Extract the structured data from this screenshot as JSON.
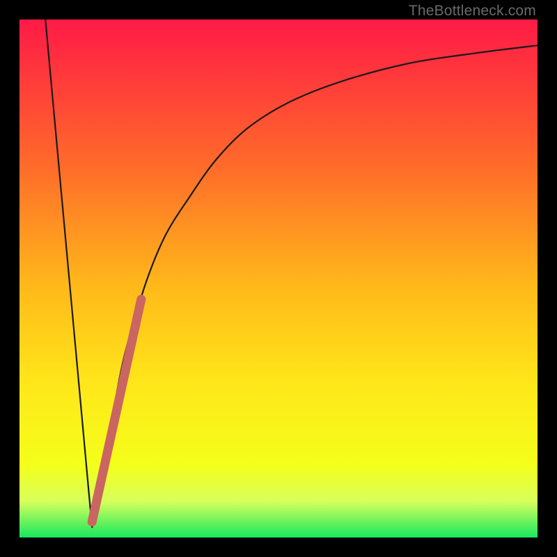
{
  "watermark": "TheBottleneck.com",
  "colors": {
    "frame": "#000000",
    "gradient_top": "#ff1a46",
    "gradient_mid1": "#ff6a2a",
    "gradient_mid2": "#ffba1a",
    "gradient_mid3": "#ffe61a",
    "gradient_mid4": "#f4ff1a",
    "gradient_green_band_top": "#d8ff5c",
    "gradient_green_band_bottom": "#17e85e",
    "curve_stroke": "#1a1a1a",
    "highlight_stroke": "#cb6561"
  },
  "chart_data": {
    "type": "line",
    "title": "",
    "xlabel": "",
    "ylabel": "",
    "xlim": [
      0,
      100
    ],
    "ylim": [
      0,
      100
    ],
    "series": [
      {
        "name": "left-descent",
        "x": [
          5,
          14
        ],
        "y": [
          100,
          2
        ]
      },
      {
        "name": "right-curve",
        "x": [
          14,
          17,
          20,
          24,
          28,
          33,
          38,
          44,
          52,
          62,
          75,
          88,
          100
        ],
        "y": [
          2,
          18,
          34,
          48,
          58,
          66,
          73,
          79,
          84,
          88,
          91.5,
          93.5,
          95
        ]
      }
    ],
    "highlight_segment": {
      "name": "emphasis",
      "x": [
        14,
        23.5
      ],
      "y": [
        3,
        46
      ]
    },
    "green_band_y": [
      0,
      6
    ]
  }
}
